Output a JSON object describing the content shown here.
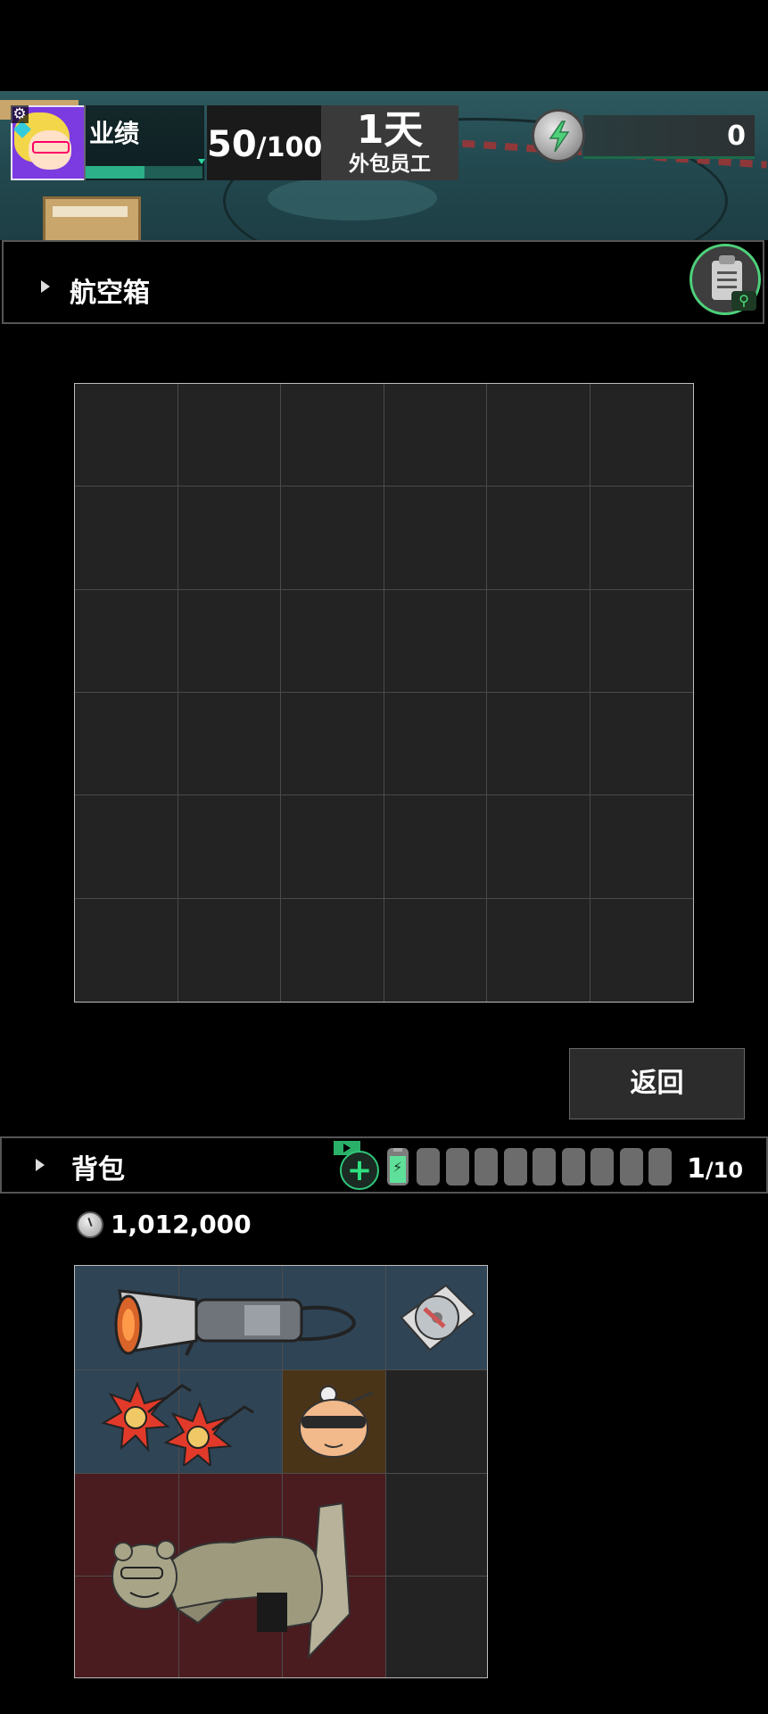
{
  "header": {
    "performance_label": "业绩",
    "performance_progress": 0.5,
    "score_current": "50",
    "score_sep": "/",
    "score_max": "100",
    "day_count": "1天",
    "role": "外包员工",
    "energy_value": "0"
  },
  "airbox": {
    "title": "航空箱",
    "rows": 6,
    "cols": 6,
    "return_label": "返回"
  },
  "backpack": {
    "title": "背包",
    "capacity_current": "1",
    "capacity_sep": "/",
    "capacity_max": "10",
    "locked_slots": 9,
    "money": "1,012,000",
    "rows": 4,
    "cols": 4,
    "items": [
      {
        "name": "heat-gun-item",
        "color": "#2f4455"
      },
      {
        "name": "disc-item",
        "color": "#2f4455"
      },
      {
        "name": "sun-ornaments-item",
        "color": "#2f4455"
      },
      {
        "name": "bulb-head-item",
        "color": "#4a3418"
      },
      {
        "name": "bear-statue-item",
        "color": "#4a1b1f"
      }
    ]
  },
  "colors": {
    "accent_green": "#2ec77a",
    "panel_dark": "#232323",
    "blue_slot": "#2f4455",
    "orange_slot": "#4a3418",
    "red_slot": "#4a1b1f"
  }
}
